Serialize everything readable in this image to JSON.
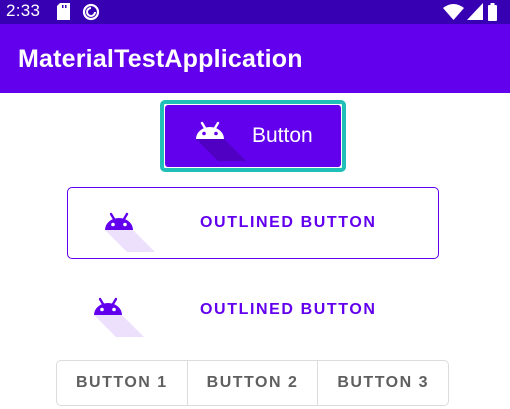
{
  "status_bar": {
    "time": "2:33",
    "icons": [
      "sd-card-icon",
      "sync-icon",
      "wifi-icon",
      "cellular-signal-icon",
      "battery-icon"
    ]
  },
  "app_bar": {
    "title": "MaterialTestApplication"
  },
  "buttons": {
    "filled": {
      "label": "Button",
      "icon": "android-icon"
    },
    "outlined": {
      "label": "OUTLINED BUTTON",
      "icon": "android-icon"
    },
    "text": {
      "label": "OUTLINED BUTTON",
      "icon": "android-icon"
    }
  },
  "toggle_group": {
    "items": [
      {
        "label": "BUTTON 1"
      },
      {
        "label": "BUTTON 2"
      },
      {
        "label": "BUTTON 3"
      }
    ]
  },
  "colors": {
    "primary": "#6200ee",
    "primary_dark": "#3700b3",
    "focus_ring": "#20c0b9",
    "on_primary": "#ffffff",
    "toggle_text": "#5f5f5f",
    "toggle_border": "#dcdcdc"
  }
}
